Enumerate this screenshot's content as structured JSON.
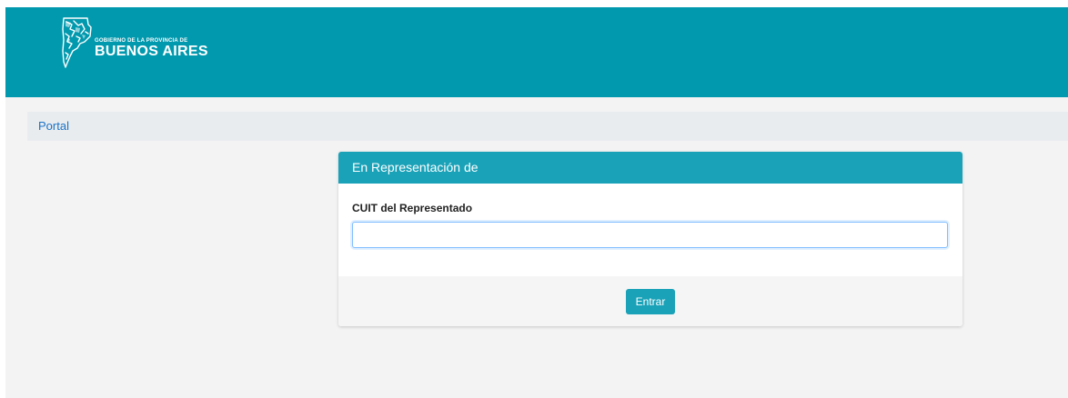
{
  "header": {
    "logo_small": "GOBIERNO DE LA PROVINCIA DE",
    "logo_big": "BUENOS AIRES",
    "logo_icon": "province-map-icon"
  },
  "breadcrumb": {
    "items": [
      {
        "label": "Portal"
      }
    ]
  },
  "card": {
    "title": "En Representación de",
    "field_label": "CUIT del Representado",
    "field_value": "",
    "field_placeholder": "",
    "submit_label": "Entrar"
  },
  "colors": {
    "header": "#0199ae",
    "accent": "#19a2b8",
    "link": "#1a73c7",
    "breadcrumb_bg": "#e9ecef",
    "page_bg": "#f3f3f3"
  }
}
